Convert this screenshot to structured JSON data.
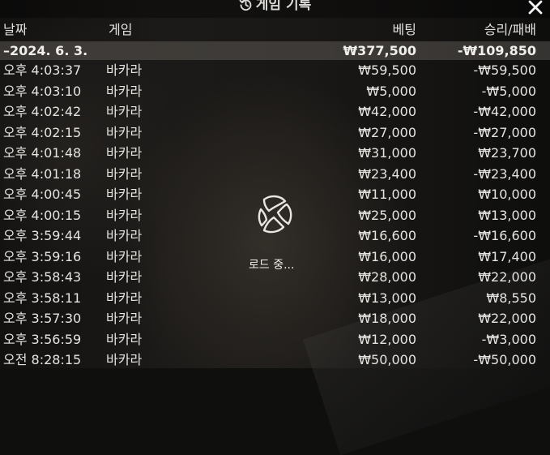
{
  "header": {
    "title": "게임 기록",
    "history_icon": "history-clock-icon",
    "close_icon": "close-icon"
  },
  "columns": {
    "date": "날짜",
    "game": "게임",
    "bet": "베팅",
    "win_loss": "승리/패배"
  },
  "summary": {
    "date": "–2024. 6. 3.",
    "bet": "₩377,500",
    "win_loss": "-₩109,850"
  },
  "rows": [
    {
      "time": "오후 4:03:37",
      "game": "바카라",
      "bet": "₩59,500",
      "win_loss": "-₩59,500"
    },
    {
      "time": "오후 4:03:10",
      "game": "바카라",
      "bet": "₩5,000",
      "win_loss": "-₩5,000"
    },
    {
      "time": "오후 4:02:42",
      "game": "바카라",
      "bet": "₩42,000",
      "win_loss": "-₩42,000"
    },
    {
      "time": "오후 4:02:15",
      "game": "바카라",
      "bet": "₩27,000",
      "win_loss": "-₩27,000"
    },
    {
      "time": "오후 4:01:48",
      "game": "바카라",
      "bet": "₩31,000",
      "win_loss": "₩23,700"
    },
    {
      "time": "오후 4:01:18",
      "game": "바카라",
      "bet": "₩23,400",
      "win_loss": "-₩23,400"
    },
    {
      "time": "오후 4:00:45",
      "game": "바카라",
      "bet": "₩11,000",
      "win_loss": "₩10,000"
    },
    {
      "time": "오후 4:00:15",
      "game": "바카라",
      "bet": "₩25,000",
      "win_loss": "₩13,000"
    },
    {
      "time": "오후 3:59:44",
      "game": "바카라",
      "bet": "₩16,600",
      "win_loss": "-₩16,600"
    },
    {
      "time": "오후 3:59:16",
      "game": "바카라",
      "bet": "₩16,000",
      "win_loss": "₩17,400"
    },
    {
      "time": "오후 3:58:43",
      "game": "바카라",
      "bet": "₩28,000",
      "win_loss": "₩22,000"
    },
    {
      "time": "오후 3:58:11",
      "game": "바카라",
      "bet": "₩13,000",
      "win_loss": "₩8,550"
    },
    {
      "time": "오후 3:57:30",
      "game": "바카라",
      "bet": "₩18,000",
      "win_loss": "₩22,000"
    },
    {
      "time": "오후 3:56:59",
      "game": "바카라",
      "bet": "₩12,000",
      "win_loss": "-₩3,000"
    },
    {
      "time": "오전 8:28:15",
      "game": "바카라",
      "bet": "₩50,000",
      "win_loss": "-₩50,000"
    }
  ],
  "loading": {
    "text": "로드 중...",
    "icon": "loading-spinner-icon"
  }
}
